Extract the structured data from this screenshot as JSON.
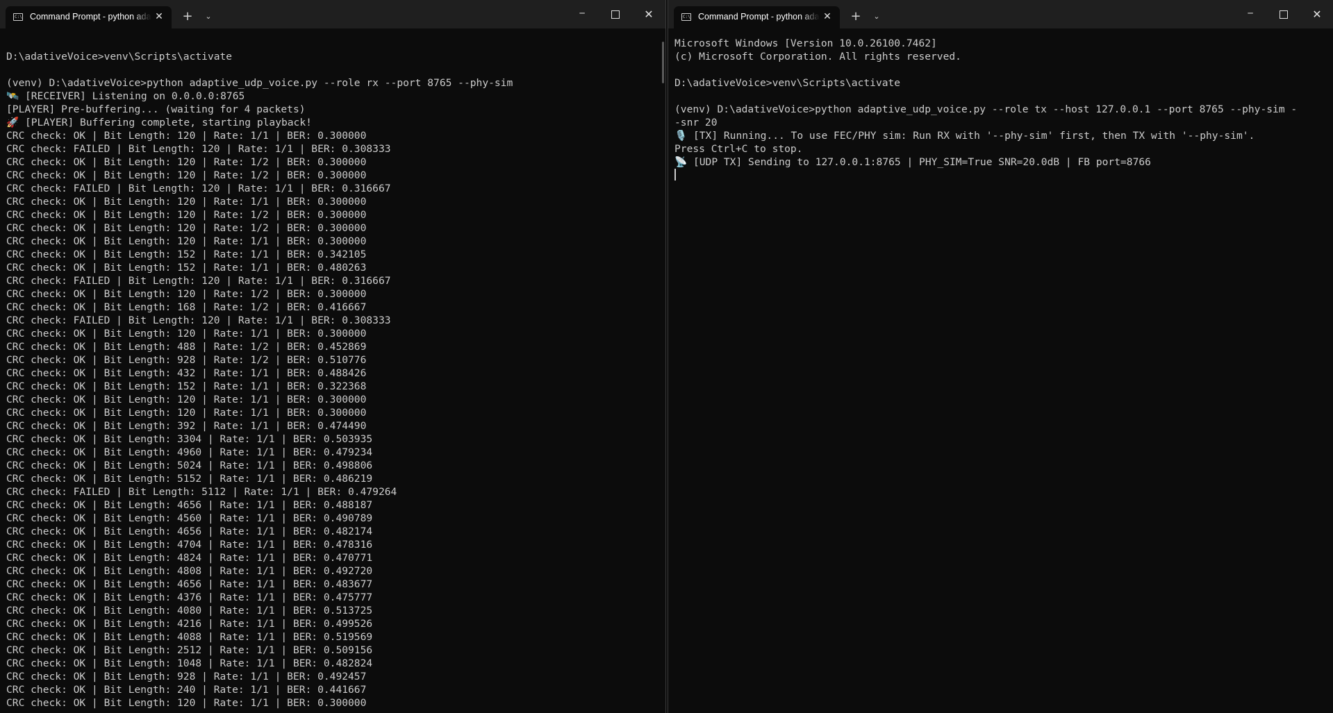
{
  "left_window": {
    "tab_title": "Command Prompt - python adaptive_udp_voice.py",
    "tab_close": "✕",
    "new_tab": "+",
    "dropdown": "⌄",
    "minimize": "─",
    "close": "✕",
    "icons": {
      "terminal": "terminal-icon"
    },
    "lines": [
      "",
      "D:\\adativeVoice>venv\\Scripts\\activate",
      "",
      "(venv) D:\\adativeVoice>python adaptive_udp_voice.py --role rx --port 8765 --phy-sim",
      "[RECEIVER] Listening on 0.0.0.0:8765",
      "[PLAYER] Pre-buffering... (waiting for 4 packets)",
      "[PLAYER] Buffering complete, starting playback!",
      "CRC check: OK | Bit Length: 120 | Rate: 1/1 | BER: 0.300000",
      "CRC check: FAILED | Bit Length: 120 | Rate: 1/1 | BER: 0.308333",
      "CRC check: OK | Bit Length: 120 | Rate: 1/2 | BER: 0.300000",
      "CRC check: OK | Bit Length: 120 | Rate: 1/2 | BER: 0.300000",
      "CRC check: FAILED | Bit Length: 120 | Rate: 1/1 | BER: 0.316667",
      "CRC check: OK | Bit Length: 120 | Rate: 1/1 | BER: 0.300000",
      "CRC check: OK | Bit Length: 120 | Rate: 1/2 | BER: 0.300000",
      "CRC check: OK | Bit Length: 120 | Rate: 1/2 | BER: 0.300000",
      "CRC check: OK | Bit Length: 120 | Rate: 1/1 | BER: 0.300000",
      "CRC check: OK | Bit Length: 152 | Rate: 1/1 | BER: 0.342105",
      "CRC check: OK | Bit Length: 152 | Rate: 1/1 | BER: 0.480263",
      "CRC check: FAILED | Bit Length: 120 | Rate: 1/1 | BER: 0.316667",
      "CRC check: OK | Bit Length: 120 | Rate: 1/2 | BER: 0.300000",
      "CRC check: OK | Bit Length: 168 | Rate: 1/2 | BER: 0.416667",
      "CRC check: FAILED | Bit Length: 120 | Rate: 1/1 | BER: 0.308333",
      "CRC check: OK | Bit Length: 120 | Rate: 1/1 | BER: 0.300000",
      "CRC check: OK | Bit Length: 488 | Rate: 1/2 | BER: 0.452869",
      "CRC check: OK | Bit Length: 928 | Rate: 1/2 | BER: 0.510776",
      "CRC check: OK | Bit Length: 432 | Rate: 1/1 | BER: 0.488426",
      "CRC check: OK | Bit Length: 152 | Rate: 1/1 | BER: 0.322368",
      "CRC check: OK | Bit Length: 120 | Rate: 1/1 | BER: 0.300000",
      "CRC check: OK | Bit Length: 120 | Rate: 1/1 | BER: 0.300000",
      "CRC check: OK | Bit Length: 392 | Rate: 1/1 | BER: 0.474490",
      "CRC check: OK | Bit Length: 3304 | Rate: 1/1 | BER: 0.503935",
      "CRC check: OK | Bit Length: 4960 | Rate: 1/1 | BER: 0.479234",
      "CRC check: OK | Bit Length: 5024 | Rate: 1/1 | BER: 0.498806",
      "CRC check: OK | Bit Length: 5152 | Rate: 1/1 | BER: 0.486219",
      "CRC check: FAILED | Bit Length: 5112 | Rate: 1/1 | BER: 0.479264",
      "CRC check: OK | Bit Length: 4656 | Rate: 1/1 | BER: 0.488187",
      "CRC check: OK | Bit Length: 4560 | Rate: 1/1 | BER: 0.490789",
      "CRC check: OK | Bit Length: 4656 | Rate: 1/1 | BER: 0.482174",
      "CRC check: OK | Bit Length: 4704 | Rate: 1/1 | BER: 0.478316",
      "CRC check: OK | Bit Length: 4824 | Rate: 1/1 | BER: 0.470771",
      "CRC check: OK | Bit Length: 4808 | Rate: 1/1 | BER: 0.492720",
      "CRC check: OK | Bit Length: 4656 | Rate: 1/1 | BER: 0.483677",
      "CRC check: OK | Bit Length: 4376 | Rate: 1/1 | BER: 0.475777",
      "CRC check: OK | Bit Length: 4080 | Rate: 1/1 | BER: 0.513725",
      "CRC check: OK | Bit Length: 4216 | Rate: 1/1 | BER: 0.499526",
      "CRC check: OK | Bit Length: 4088 | Rate: 1/1 | BER: 0.519569",
      "CRC check: OK | Bit Length: 2512 | Rate: 1/1 | BER: 0.509156",
      "CRC check: OK | Bit Length: 1048 | Rate: 1/1 | BER: 0.482824",
      "CRC check: OK | Bit Length: 928 | Rate: 1/1 | BER: 0.492457",
      "CRC check: OK | Bit Length: 240 | Rate: 1/1 | BER: 0.441667",
      "CRC check: OK | Bit Length: 120 | Rate: 1/1 | BER: 0.300000"
    ],
    "glyphs": {
      "4": "🛰️",
      "6": "🚀"
    }
  },
  "right_window": {
    "tab_title": "Command Prompt - python adaptive_udp_voice.py",
    "tab_close": "✕",
    "new_tab": "+",
    "dropdown": "⌄",
    "minimize": "─",
    "close": "✕",
    "icons": {
      "terminal": "terminal-icon"
    },
    "lines": [
      "Microsoft Windows [Version 10.0.26100.7462]",
      "(c) Microsoft Corporation. All rights reserved.",
      "",
      "D:\\adativeVoice>venv\\Scripts\\activate",
      "",
      "(venv) D:\\adativeVoice>python adaptive_udp_voice.py --role tx --host 127.0.0.1 --port 8765 --phy-sim -",
      "-snr 20",
      "[TX] Running... To use FEC/PHY sim: Run RX with '--phy-sim' first, then TX with '--phy-sim'.",
      "Press Ctrl+C to stop.",
      "[UDP TX] Sending to 127.0.0.1:8765 | PHY_SIM=True SNR=20.0dB | FB port=8766",
      ""
    ],
    "glyphs": {
      "7": "🎙️",
      "9": "📡"
    },
    "cursor_line": 10
  }
}
